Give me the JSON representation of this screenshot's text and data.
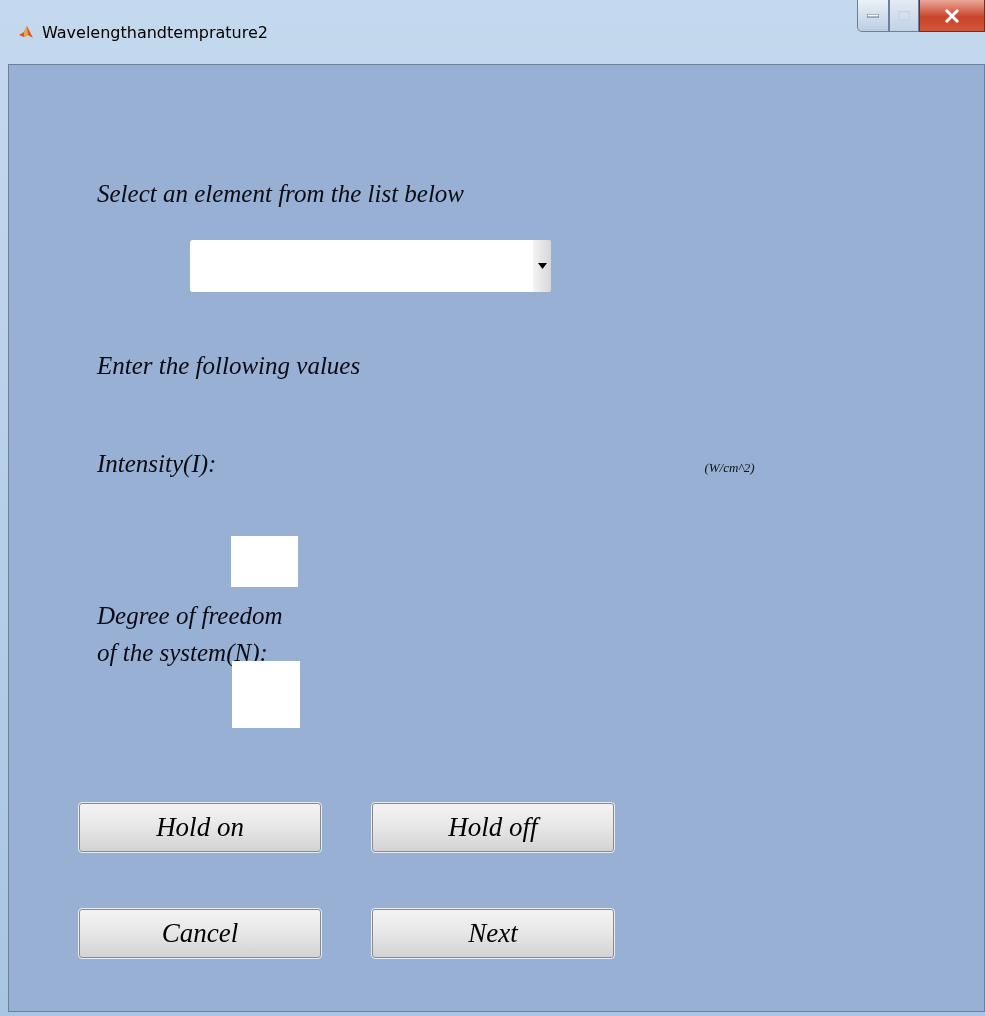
{
  "window": {
    "title": "Wavelengthandtemprature2"
  },
  "element_prompt": "Select an element from the list below",
  "values_prompt": "Enter the following values",
  "intensity": {
    "label": "Intensity(I):",
    "unit": "(W/cm^2)"
  },
  "degrees_of_freedom": {
    "label": "Degree of freedom\nof the system(N):"
  },
  "buttons": [
    {
      "label": "Hold on"
    },
    {
      "label": "Hold off"
    },
    {
      "label": "Cancel"
    },
    {
      "label": "Next"
    }
  ]
}
